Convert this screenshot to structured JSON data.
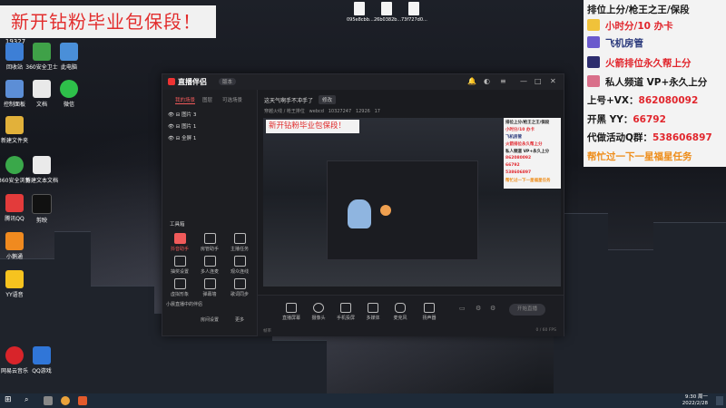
{
  "banner": "新开钻粉毕业包保段！",
  "capture_label": "19327",
  "desktop_icons": [
    {
      "label": "回收站",
      "color": "#3d7fd6"
    },
    {
      "label": "360安全卫士",
      "color": "#3fa148"
    },
    {
      "label": "此电脑",
      "color": "#4a8fd8"
    },
    {
      "label": "文档",
      "color": "#e9e9e9"
    },
    {
      "label": "微信",
      "color": "#2ec04a"
    },
    {
      "label": "控制面板",
      "color": "#5c8ed6"
    },
    {
      "label": "新建文件夹",
      "color": "#e2b13a"
    },
    {
      "label": "360安全浏览器",
      "color": "#3aa84a"
    },
    {
      "label": "新建文本文档",
      "color": "#eaeaea"
    },
    {
      "label": "腾讯QQ",
      "color": "#e33b3b"
    },
    {
      "label": "剪映",
      "color": "#111111"
    },
    {
      "label": "小鹅通",
      "color": "#f08a1f"
    },
    {
      "label": "YY语音",
      "color": "#f6c31f"
    },
    {
      "label": "网易云音乐",
      "color": "#d8242a"
    },
    {
      "label": "QQ游戏",
      "color": "#3076d8"
    }
  ],
  "files": [
    {
      "label": "095e8cbb..."
    },
    {
      "label": "26b0382b..."
    },
    {
      "label": "73f727d0..."
    }
  ],
  "right_panel": {
    "line1": "排位上分/枪王之王/保段",
    "line2": "小时分/10 办卡",
    "line3": "飞机房管",
    "line4": "火箭排位永久帮上分",
    "line5": "私人频道 VP+永久上分",
    "line6_label": "上号+VX：",
    "line6_value": "862080092",
    "line7_label": "开黑 YY：",
    "line7_value": "66792",
    "line8_label": "代做活动Q群：",
    "line8_value": "538606897",
    "line9": "帮忙过一下一星福星任务"
  },
  "app": {
    "name": "直播伴侣",
    "version": "版本",
    "tabs": [
      "我的场景",
      "图层",
      "可选场景"
    ],
    "scenes": [
      "图片 3",
      "图片 1",
      "全屏 1"
    ],
    "tools_title": "工具箱",
    "tools": [
      "抖音助手",
      "房管助手",
      "主播任务",
      "抽奖设置",
      "多人连麦",
      "观众连线",
      "虚拟形象",
      "弹幕墙",
      "歌词同步",
      "小晨直播中的伴侣",
      "房间设置",
      "更多"
    ],
    "stream_title": "这天气啊手不冲手了",
    "edit_label": "修改",
    "info_category": "穿越火线 / 枪王排位",
    "info_id": "webcd",
    "info_viewers": "10327247",
    "info_likes": "12926",
    "info_count": "17",
    "bottom_tools": [
      "直播屏幕",
      "摄像头",
      "手机投屏",
      "多媒体",
      "麦克风",
      "扬声器"
    ],
    "go_live": "开始直播",
    "status_left": "帧率",
    "status_right": "0 / 60 FPS"
  },
  "clock": {
    "time": "9:30 周一",
    "date": "2022/2/28"
  }
}
